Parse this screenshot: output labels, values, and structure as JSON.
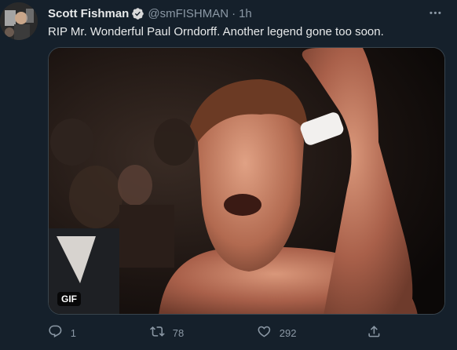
{
  "tweet": {
    "author_name": "Scott Fishman",
    "author_handle": "@smFISHMAN",
    "separator": "·",
    "time": "1h",
    "text": "RIP Mr. Wonderful Paul Orndorff. Another legend gone too soon.",
    "media_badge": "GIF",
    "icons": {
      "verified": "verified-badge-icon",
      "more": "more-options-icon",
      "reply": "reply-icon",
      "retweet": "retweet-icon",
      "like": "like-icon",
      "share": "share-icon"
    }
  },
  "actions": {
    "reply_count": "1",
    "retweet_count": "78",
    "like_count": "292"
  },
  "colors": {
    "background": "#15202b",
    "text_primary": "#e7e9ea",
    "text_secondary": "#8b98a5",
    "verified": "#1d9bf0",
    "border": "#38444d"
  }
}
